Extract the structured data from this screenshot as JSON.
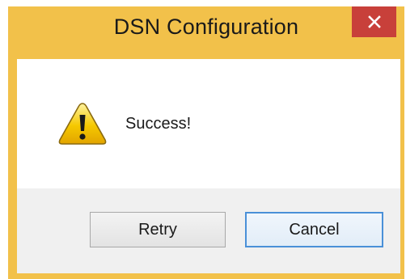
{
  "window": {
    "title": "DSN Configuration",
    "close_symbol": "✕",
    "frame_color": "#f2c14a",
    "close_color": "#c8403a"
  },
  "dialog": {
    "icon": "warning-icon",
    "message": "Success!"
  },
  "buttons": {
    "retry_label": "Retry",
    "cancel_label": "Cancel"
  }
}
